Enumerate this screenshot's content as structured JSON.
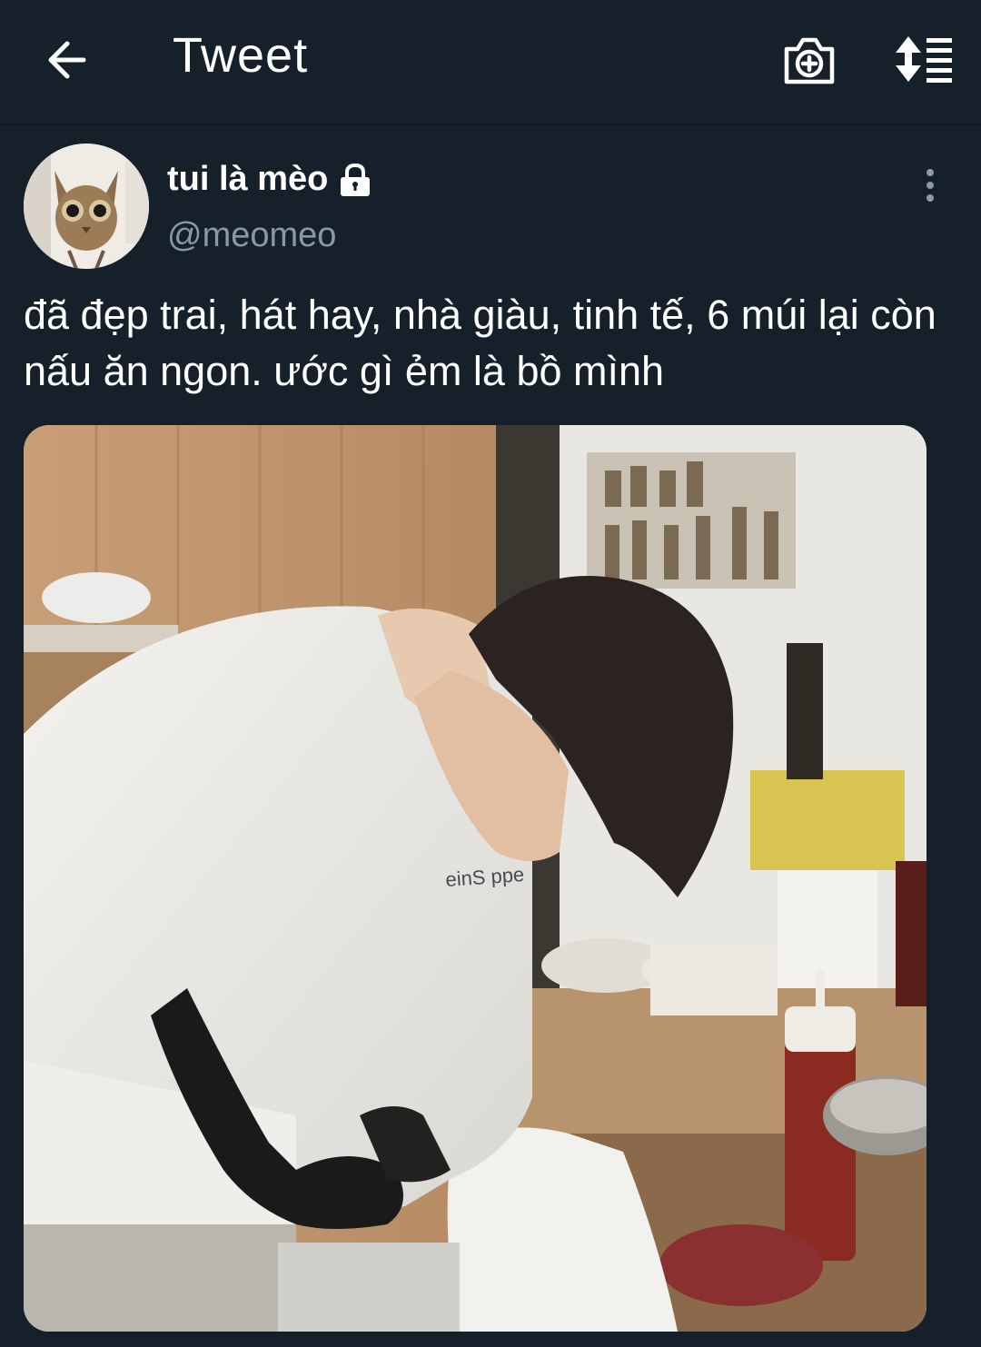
{
  "header": {
    "title": "Tweet",
    "back_icon": "arrow-left-icon",
    "camera_icon": "camera-add-icon",
    "sort_icon": "sort-icon"
  },
  "tweet": {
    "author": {
      "display_name": "tui là mèo",
      "handle": "@meomeo",
      "protected_icon": "lock-icon",
      "avatar_icon": "cat-avatar"
    },
    "text": "đã đẹp trai, hát hay, nhà giàu, tinh tế, 6 múi lại còn nấu ăn ngon. ước gì ẻm là bồ mình",
    "more_icon": "more-vertical-icon",
    "media": {
      "kind": "photo",
      "apron_text": "einS ppe"
    }
  },
  "colors": {
    "background": "#15202b",
    "text": "#ffffff",
    "secondary_text": "#8899a6"
  }
}
